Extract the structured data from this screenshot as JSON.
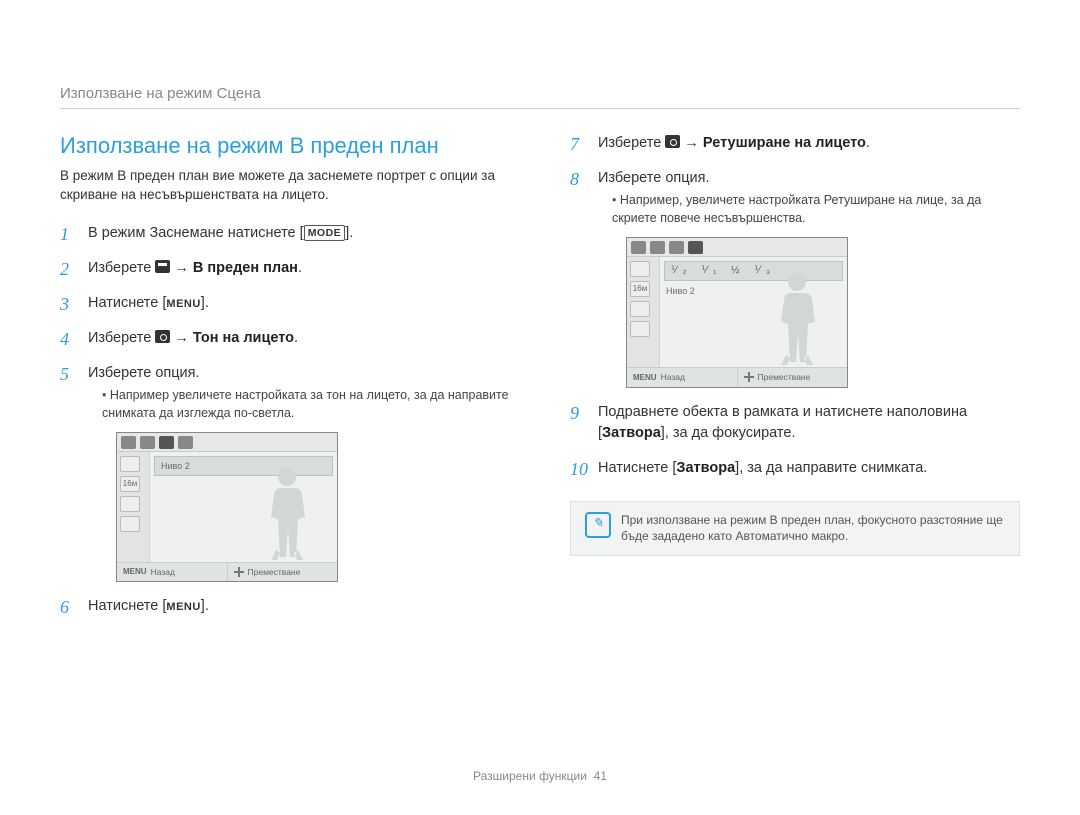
{
  "breadcrumb": "Използване на режим Сцена",
  "section_title": "Използване на режим В преден план",
  "intro": "В режим В преден план вие можете да заснемете портрет с опции за скриване на несъвършенствата на лицето.",
  "left_steps": [
    {
      "num": "1",
      "prefix": "В режим Заснемане натиснете [",
      "key": "MODE",
      "suffix": "]."
    },
    {
      "num": "2",
      "prefix": "Изберете ",
      "icon": "scene",
      "arrow": " → ",
      "bold": "В преден план",
      "suffix": "."
    },
    {
      "num": "3",
      "prefix": "Натиснете [",
      "menu": "MENU",
      "suffix": "]."
    },
    {
      "num": "4",
      "prefix": "Изберете ",
      "icon": "camera",
      "arrow": " → ",
      "bold": "Тон на лицето",
      "suffix": "."
    },
    {
      "num": "5",
      "prefix": "Изберете опция.",
      "sub": "Например увеличете настройката за тон на лицето, за да направите снимката да изглежда по-светла."
    },
    {
      "num": "6",
      "prefix": "Натиснете [",
      "menu": "MENU",
      "suffix": "]."
    }
  ],
  "right_steps": [
    {
      "num": "7",
      "prefix": "Изберете ",
      "icon": "camera",
      "arrow": " → ",
      "bold": "Ретуширане на лицето",
      "suffix": "."
    },
    {
      "num": "8",
      "prefix": "Изберете опция.",
      "sub": "Например, увеличете настройката Ретуширане на лице, за да скриете повече несъвършенства."
    },
    {
      "num": "9",
      "text_parts": [
        "Подравнете обекта в рамката и натиснете наполовина [",
        "Затвора",
        "], за да фокусирате."
      ]
    },
    {
      "num": "10",
      "text_parts": [
        "Натиснете [",
        "Затвора",
        "], за да направите снимката."
      ]
    }
  ],
  "lcd": {
    "level_marks": "⅟₂ ⅟₁ ½ ⅟₃",
    "level_text": "Ниво 2",
    "sidebar_labels": [
      "",
      "16м",
      "",
      ""
    ],
    "back_key": "MENU",
    "back_label": "Назад",
    "move_label": "Преместване"
  },
  "note": {
    "text": "При използване на режим В преден план, фокусното разстояние ще бъде зададено като Автоматично макро."
  },
  "footer": {
    "label": "Разширени функции",
    "page": "41"
  }
}
